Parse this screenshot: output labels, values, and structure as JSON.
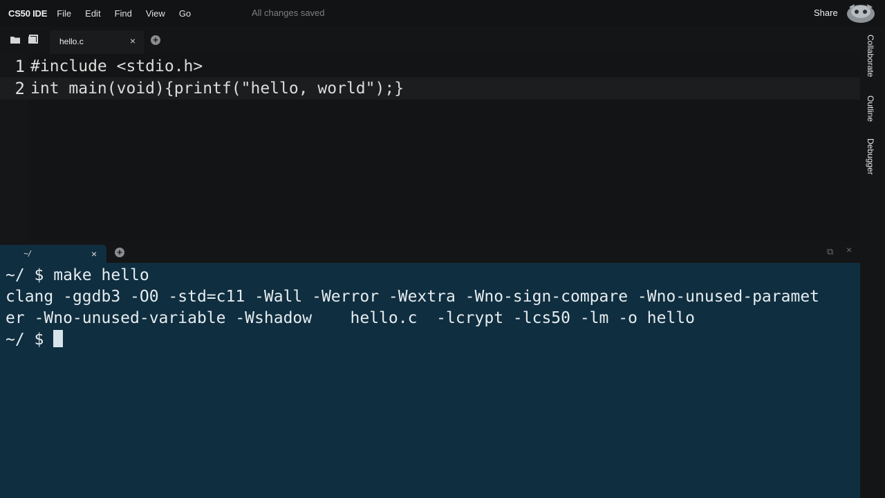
{
  "menubar": {
    "brand": "CS50 IDE",
    "items": [
      "File",
      "Edit",
      "Find",
      "View",
      "Go"
    ],
    "status": "All changes saved",
    "share": "Share"
  },
  "editor": {
    "tab": {
      "label": "hello.c",
      "close": "×"
    },
    "add_tab": "+",
    "lines": [
      {
        "number": "1",
        "text": "#include <stdio.h>"
      },
      {
        "number": "2",
        "text": "int main(void){printf(\"hello, world\");}"
      }
    ]
  },
  "sidebar": {
    "tabs": [
      "Collaborate",
      "Outline",
      "Debugger"
    ]
  },
  "terminal": {
    "tab": {
      "label": "~/",
      "close": "×"
    },
    "add_tab": "+",
    "controls": {
      "maximize": "⧉",
      "close": "×"
    },
    "lines": [
      "~/ $ make hello",
      "clang -ggdb3 -O0 -std=c11 -Wall -Werror -Wextra -Wno-sign-compare -Wno-unused-paramet",
      "er -Wno-unused-variable -Wshadow    hello.c  -lcrypt -lcs50 -lm -o hello"
    ],
    "prompt": "~/ $ "
  },
  "colors": {
    "terminal_bg": "#0f2e40",
    "editor_bg": "#131415",
    "menubar_bg": "#121314"
  }
}
